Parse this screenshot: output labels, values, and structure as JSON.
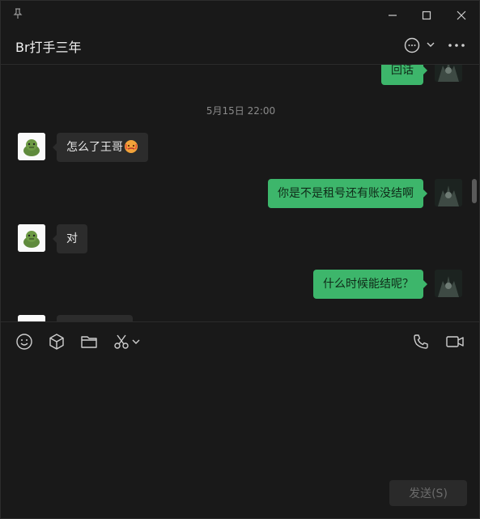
{
  "window": {
    "pin_icon": "pin-icon",
    "controls": [
      "minimize-icon",
      "maximize-icon",
      "close-icon"
    ]
  },
  "header": {
    "title": "Br打手三年",
    "icons": [
      "chat-bubble-icon",
      "chevron-down-icon",
      "more-icon"
    ]
  },
  "messages": {
    "partial_top": {
      "side": "right",
      "text": "回话"
    },
    "timestamp": "5月15日 22:00",
    "items": [
      {
        "side": "left",
        "text": "怎么了王哥"
      },
      {
        "side": "right",
        "text": "你是不是租号还有账没结啊"
      },
      {
        "side": "left",
        "text": "对"
      },
      {
        "side": "right",
        "text": "什么时候能结呢？"
      }
    ],
    "emoji": "hot-face-emoji"
  },
  "toolbar": {
    "left_icons": [
      "emoji-icon",
      "cube-icon",
      "folder-icon",
      "scissors-icon",
      "chevron-down-icon"
    ],
    "right_icons": [
      "phone-icon",
      "video-icon"
    ]
  },
  "composer": {
    "send_label": "发送(S)"
  },
  "colors": {
    "background": "#191919",
    "bubble_left": "#2c2c2c",
    "bubble_right": "#3db66b",
    "timestamp": "#8a8a8a"
  }
}
